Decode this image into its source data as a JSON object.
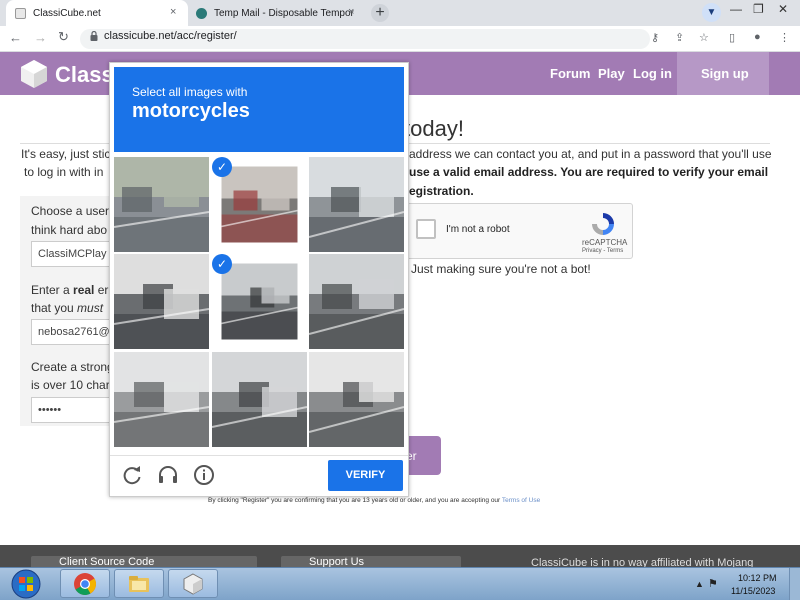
{
  "browser": {
    "tabs": [
      {
        "title": "ClassiCube.net",
        "active": true
      },
      {
        "title": "Temp Mail - Disposable Tempora",
        "active": false
      }
    ],
    "new_tab": "+",
    "close_glyph": "×",
    "url": "classicube.net/acc/register/",
    "window_controls": {
      "minimize": "—",
      "restore": "❐",
      "close": "✕"
    }
  },
  "site": {
    "logo_text": "Classi",
    "nav": {
      "forum": "Forum",
      "play": "Play",
      "login": "Log in",
      "signup": "Sign up"
    },
    "heading": "today!",
    "intro_line1_left": "It's easy, just stic",
    "intro_line1_right": "address we can contact you at, and put in a password that you'll use",
    "intro_line2_left": "to log in with in",
    "intro_line2_right": "use a valid email address. You are required to verify your email",
    "intro_line3_right": "egistration.",
    "username_label_1": "Choose a user",
    "username_label_2": "think hard abo",
    "username_value": "ClassiMCPlay",
    "email_label_1_pre": "Enter a ",
    "email_label_1_bold": "real",
    "email_label_1_post": " er",
    "email_label_2_pre": "that you ",
    "email_label_2_italic": "must",
    "email_value": "nebosa2761@",
    "password_label_1": "Create a strong",
    "password_label_2": "is over 10 char",
    "password_value": "••••••",
    "recaptcha_label": "I'm not a robot",
    "recaptcha_brand": "reCAPTCHA",
    "recaptcha_links": "Privacy - Terms",
    "bot_note": "Just making sure you're not a bot!",
    "register_label": "er",
    "terms_pre": "By clicking \"Register\" you are confirming that you are 13 years old or older, and you are accepting our ",
    "terms_link": "Terms of Use",
    "footer_box_1": "Client Source Code",
    "footer_box_2": "Support Us",
    "footer_disclaimer": "ClassiCube is in no way affiliated with Mojang"
  },
  "captcha": {
    "instruction": "Select all images with",
    "target": "motorcycles",
    "selected_tiles": [
      1,
      4
    ],
    "verify_label": "VERIFY",
    "accent": "#1a73e8"
  },
  "taskbar": {
    "time": "10:12 PM",
    "date": "11/15/2023",
    "tray_arrow": "▲"
  },
  "colors": {
    "site_purple": "#a27bb4",
    "captcha_blue": "#1a73e8"
  }
}
